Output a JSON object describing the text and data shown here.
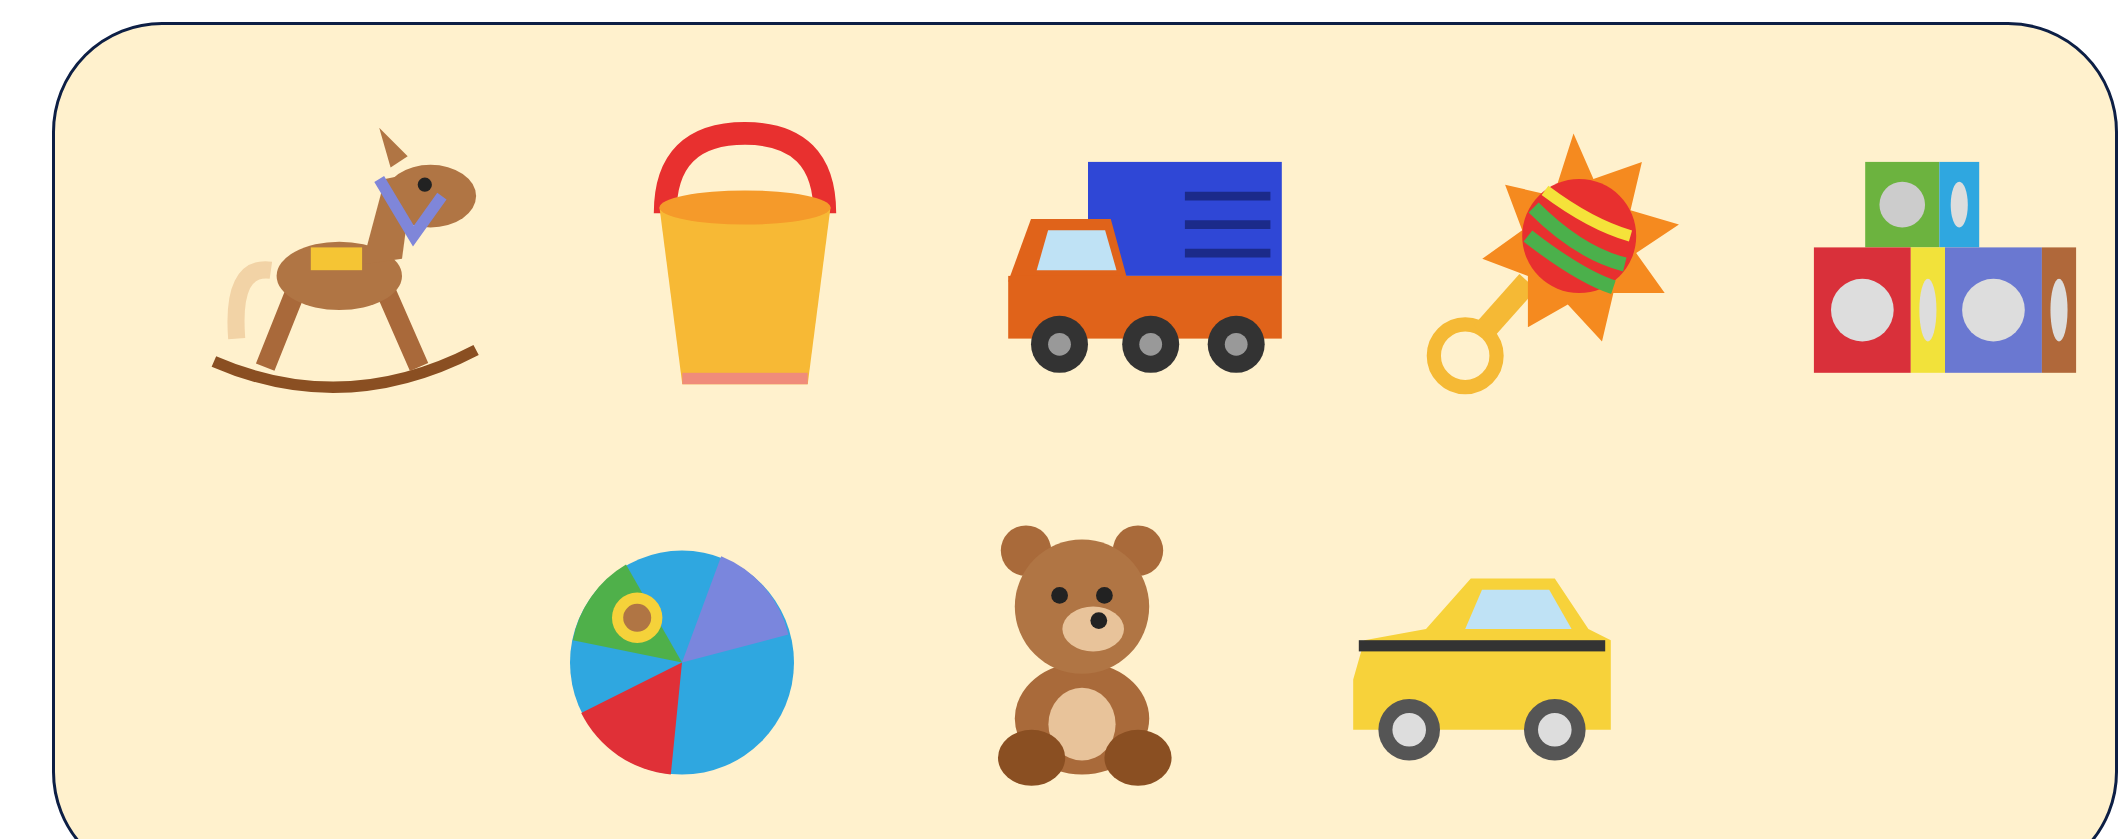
{
  "rows": [
    {
      "toys": [
        {
          "kind": "horse"
        },
        {
          "kind": "bucket"
        },
        {
          "kind": "truck"
        },
        {
          "kind": "rattle"
        },
        {
          "kind": "blocks"
        }
      ]
    },
    {
      "toys": [
        {
          "kind": "ball"
        },
        {
          "kind": "bear"
        },
        {
          "kind": "taxi"
        }
      ]
    }
  ]
}
